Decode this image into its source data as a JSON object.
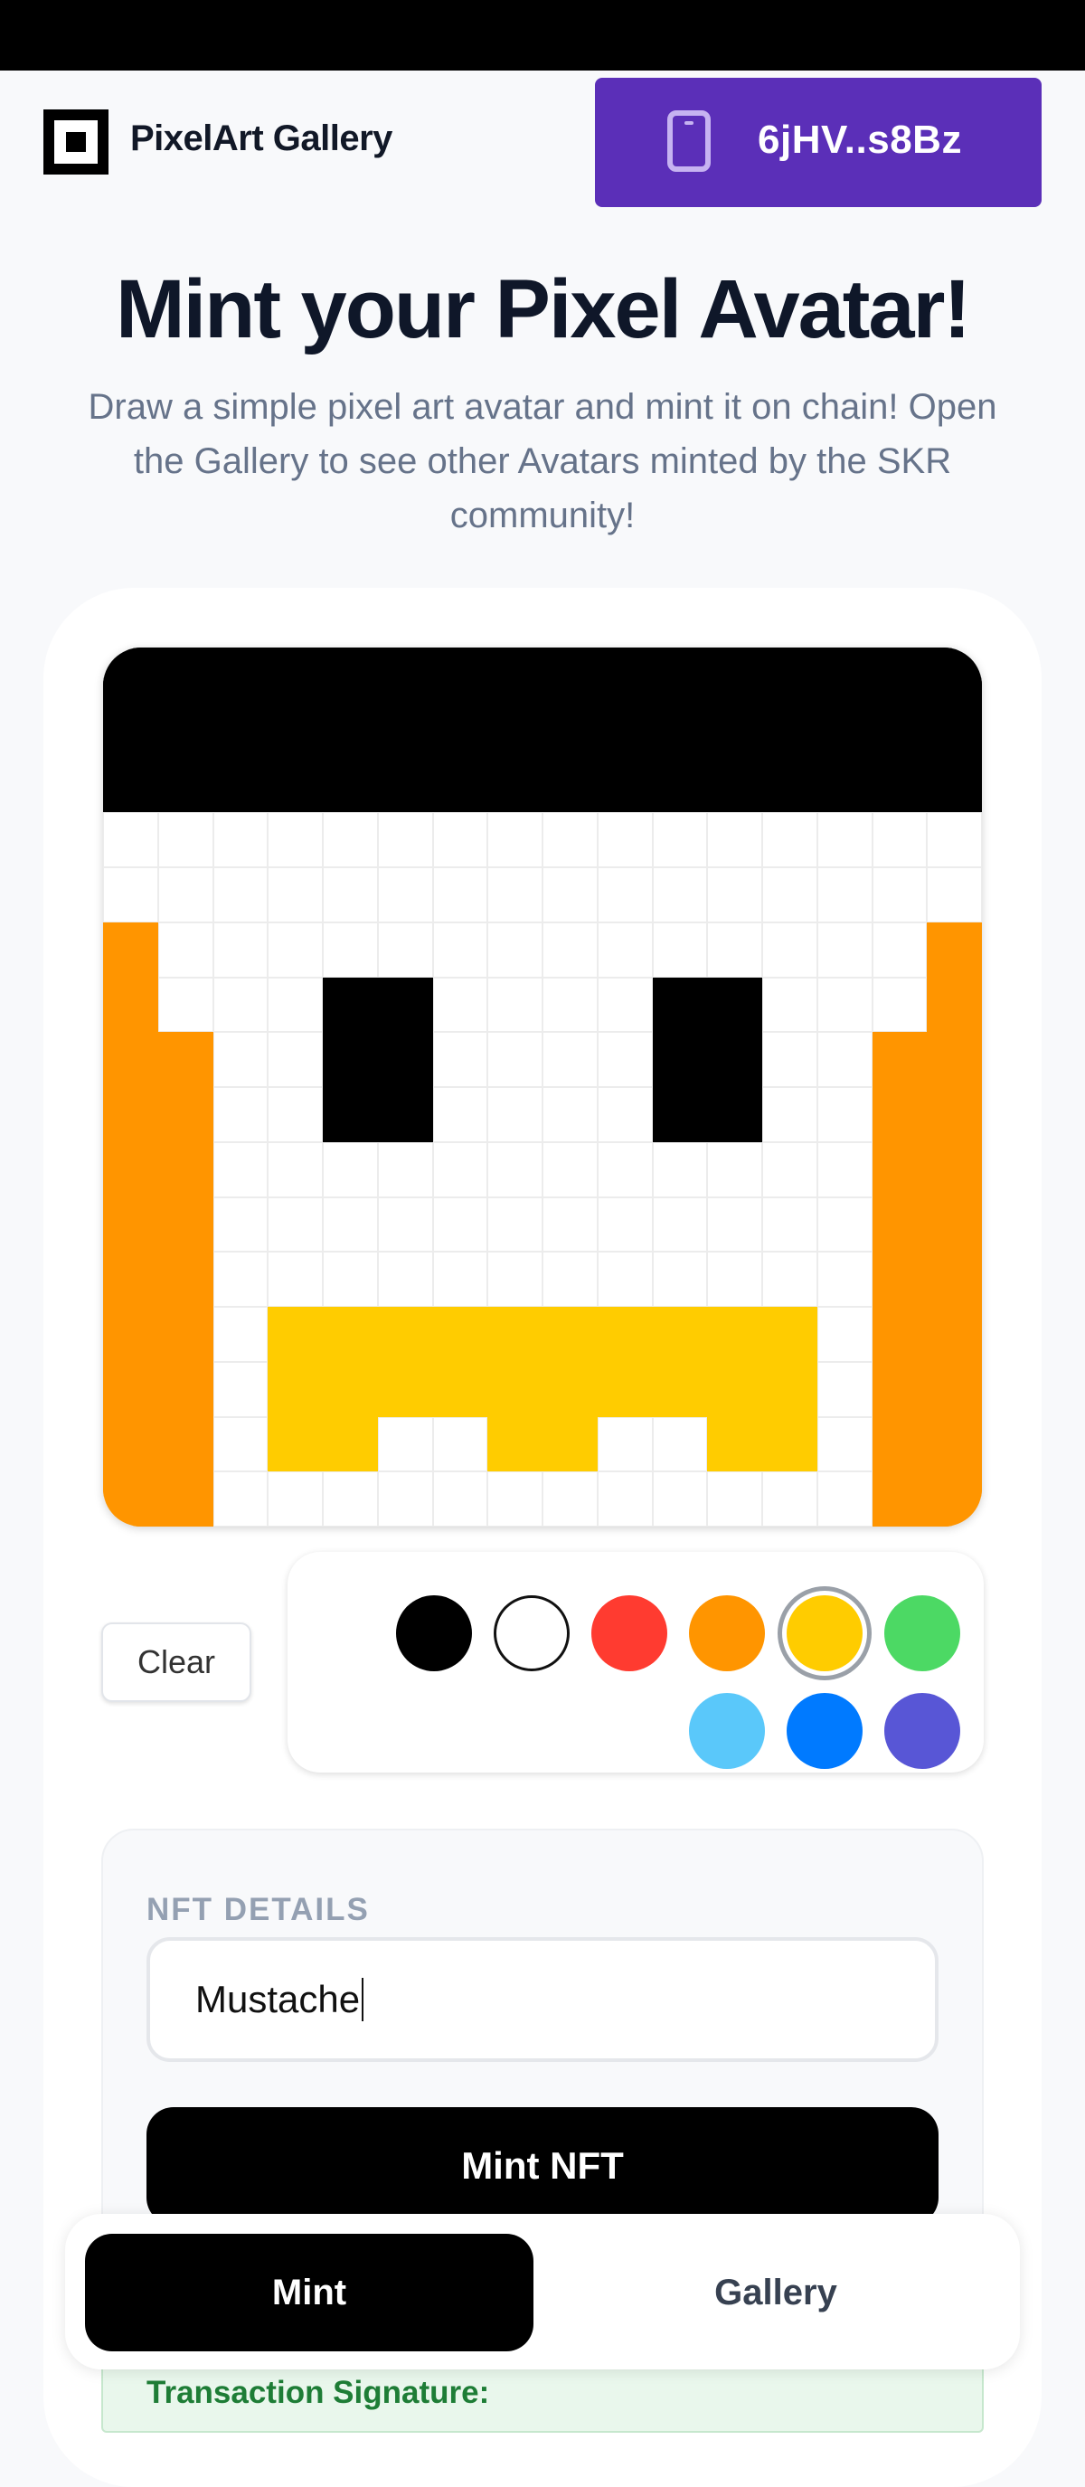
{
  "header": {
    "brand": "PixelArt Gallery",
    "wallet_address": "6jHV..s8Bz"
  },
  "hero": {
    "title": "Mint your Pixel Avatar!",
    "description": "Draw a simple pixel art avatar and mint it on chain! Open the Gallery to see other Avatars minted by the SKR community!"
  },
  "editor": {
    "pixels": [
      "1111111111111111",
      "1111111111111111",
      "1111111111111111",
      "0000000000000000",
      "0000000000000000",
      "2000000000000002",
      "2000110000110002",
      "2200110000110022",
      "2200110000110022",
      "2200000000000022",
      "2200000000000022",
      "2200000000000022",
      "2203333333333022",
      "2203333333333022",
      "2203300330033022",
      "2200000000000022"
    ],
    "colors": {
      "0": "#ffffff",
      "1": "#000000",
      "2": "#ff9500",
      "3": "#ffcc00"
    },
    "clear_label": "Clear",
    "palette": [
      {
        "name": "black",
        "color": "#000000"
      },
      {
        "name": "white",
        "color": "#ffffff"
      },
      {
        "name": "red",
        "color": "#ff3b30"
      },
      {
        "name": "orange",
        "color": "#ff9500"
      },
      {
        "name": "yellow",
        "color": "#ffcc00"
      },
      {
        "name": "green",
        "color": "#4cd964"
      },
      {
        "name": "light-blue",
        "color": "#5ac8fa"
      },
      {
        "name": "blue",
        "color": "#007aff"
      },
      {
        "name": "indigo",
        "color": "#5856d6"
      }
    ],
    "selected_color": "yellow"
  },
  "details": {
    "section_label": "NFT DETAILS",
    "name_value": "Mustache",
    "mint_label": "Mint NFT"
  },
  "result": {
    "tx_label": "Transaction Signature:"
  },
  "nav": {
    "tabs": [
      {
        "label": "Mint",
        "active": true
      },
      {
        "label": "Gallery",
        "active": false
      }
    ]
  }
}
